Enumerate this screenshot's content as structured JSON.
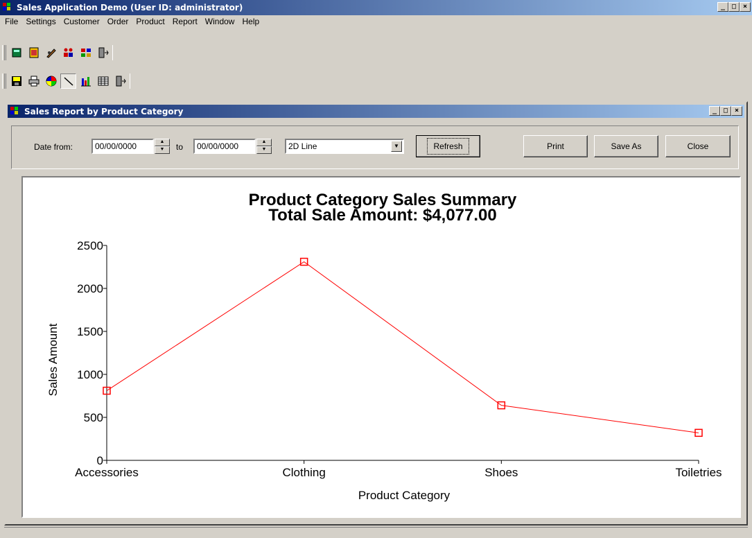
{
  "app": {
    "title": "Sales Application Demo (User ID: administrator)"
  },
  "menu": [
    "File",
    "Settings",
    "Customer",
    "Order",
    "Product",
    "Report",
    "Window",
    "Help"
  ],
  "toolbar1": {
    "icons": [
      "book-icon",
      "notepad-icon",
      "pencil-icon",
      "people-icon",
      "products-icon",
      "exit-icon"
    ]
  },
  "toolbar2": {
    "icons": [
      "save-icon",
      "printer-icon",
      "pie-chart-icon",
      "line-chart-icon",
      "bar-chart-icon",
      "table-icon",
      "exit-icon"
    ],
    "pressed": "line-chart-icon"
  },
  "report_window": {
    "title": "Sales Report by Product Category",
    "date_from_label": "Date from:",
    "date_from_value": "00/00/0000",
    "to_label": "to",
    "date_to_value": "00/00/0000",
    "chart_type": "2D Line",
    "refresh_label": "Refresh",
    "print_label": "Print",
    "save_as_label": "Save As",
    "close_label": "Close"
  },
  "chart_data": {
    "type": "line",
    "title": "Product Category Sales Summary",
    "subtitle": "Total Sale Amount:  $4,077.00",
    "xlabel": "Product Category",
    "ylabel": "Sales Amount",
    "categories": [
      "Accessories",
      "Clothing",
      "Shoes",
      "Toiletries"
    ],
    "values": [
      810,
      2310,
      640,
      320
    ],
    "ylim": [
      0,
      2500
    ],
    "yticks": [
      0,
      500,
      1000,
      1500,
      2000,
      2500
    ],
    "grid": false,
    "marker": "square",
    "color": "#ff0000"
  }
}
